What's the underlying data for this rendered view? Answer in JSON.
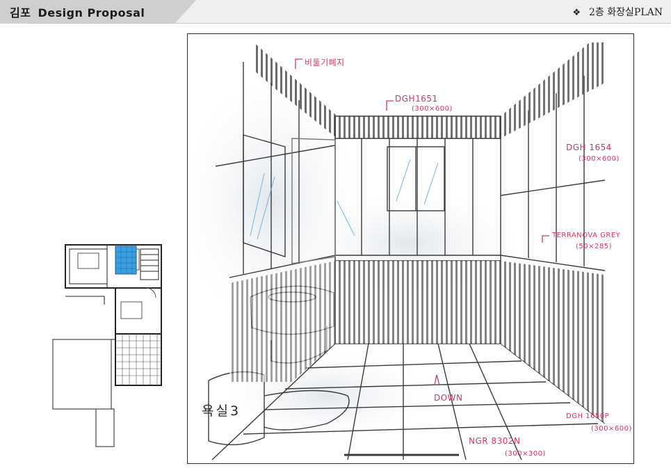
{
  "header": {
    "brand": "김포",
    "title": "Design Proposal",
    "bullet_icon": "diamond-bullet-icon",
    "section": "2층 화장실PLAN"
  },
  "sketch": {
    "labels": {
      "border": "비둘기폐지",
      "ceiling_tile": "DGH1651",
      "ceiling_tile_size": "(300×600)",
      "wall_tile": "DGH 1654",
      "wall_tile_size": "(300×600)",
      "border_tile": "TERRANOVA GREY",
      "border_tile_size": "(50×285)",
      "step": "DOWN",
      "lower_wall_tile": "DGH 1650P",
      "lower_wall_tile_size": "(300×600)",
      "floor_tile": "NGR 8302N",
      "floor_tile_size": "(300×300)"
    },
    "caption": "욕실3"
  },
  "colors": {
    "annotation": "#d4345c",
    "highlight_room": "#3a9fe0",
    "sketch_line": "#3a3a3a"
  }
}
